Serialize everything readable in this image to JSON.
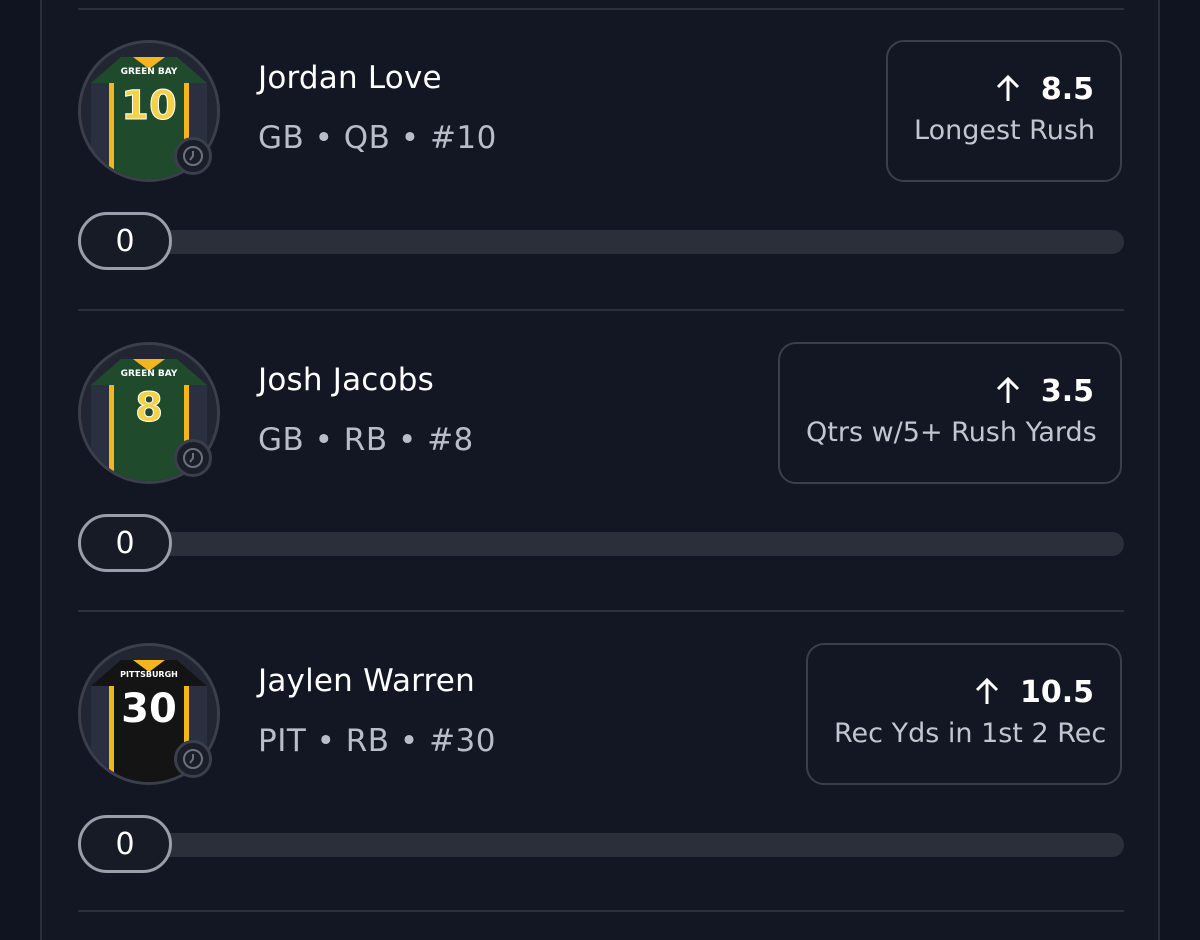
{
  "colors": {
    "background": "#0f1420",
    "panel": "#121723",
    "border": "#3a3f4b",
    "green_jersey": "#1f4a2c",
    "gold": "#f3b61f",
    "black_jersey": "#141414"
  },
  "players": [
    {
      "name": "Jordan Love",
      "meta": "GB • QB • #10",
      "jersey_team": "GREEN BAY",
      "jersey_number": "10",
      "line": "8.5",
      "stat": "Longest Rush",
      "progress_value": "0",
      "direction_icon": "arrow-up-icon"
    },
    {
      "name": "Josh Jacobs",
      "meta": "GB • RB • #8",
      "jersey_team": "GREEN BAY",
      "jersey_number": "8",
      "line": "3.5",
      "stat": "Qtrs w/5+ Rush Yards",
      "progress_value": "0",
      "direction_icon": "arrow-up-icon"
    },
    {
      "name": "Jaylen Warren",
      "meta": "PIT • RB • #30",
      "jersey_team": "PITTSBURGH",
      "jersey_number": "30",
      "line": "10.5",
      "stat": "Rec Yds in 1st 2 Rec",
      "progress_value": "0",
      "direction_icon": "arrow-up-icon"
    }
  ]
}
